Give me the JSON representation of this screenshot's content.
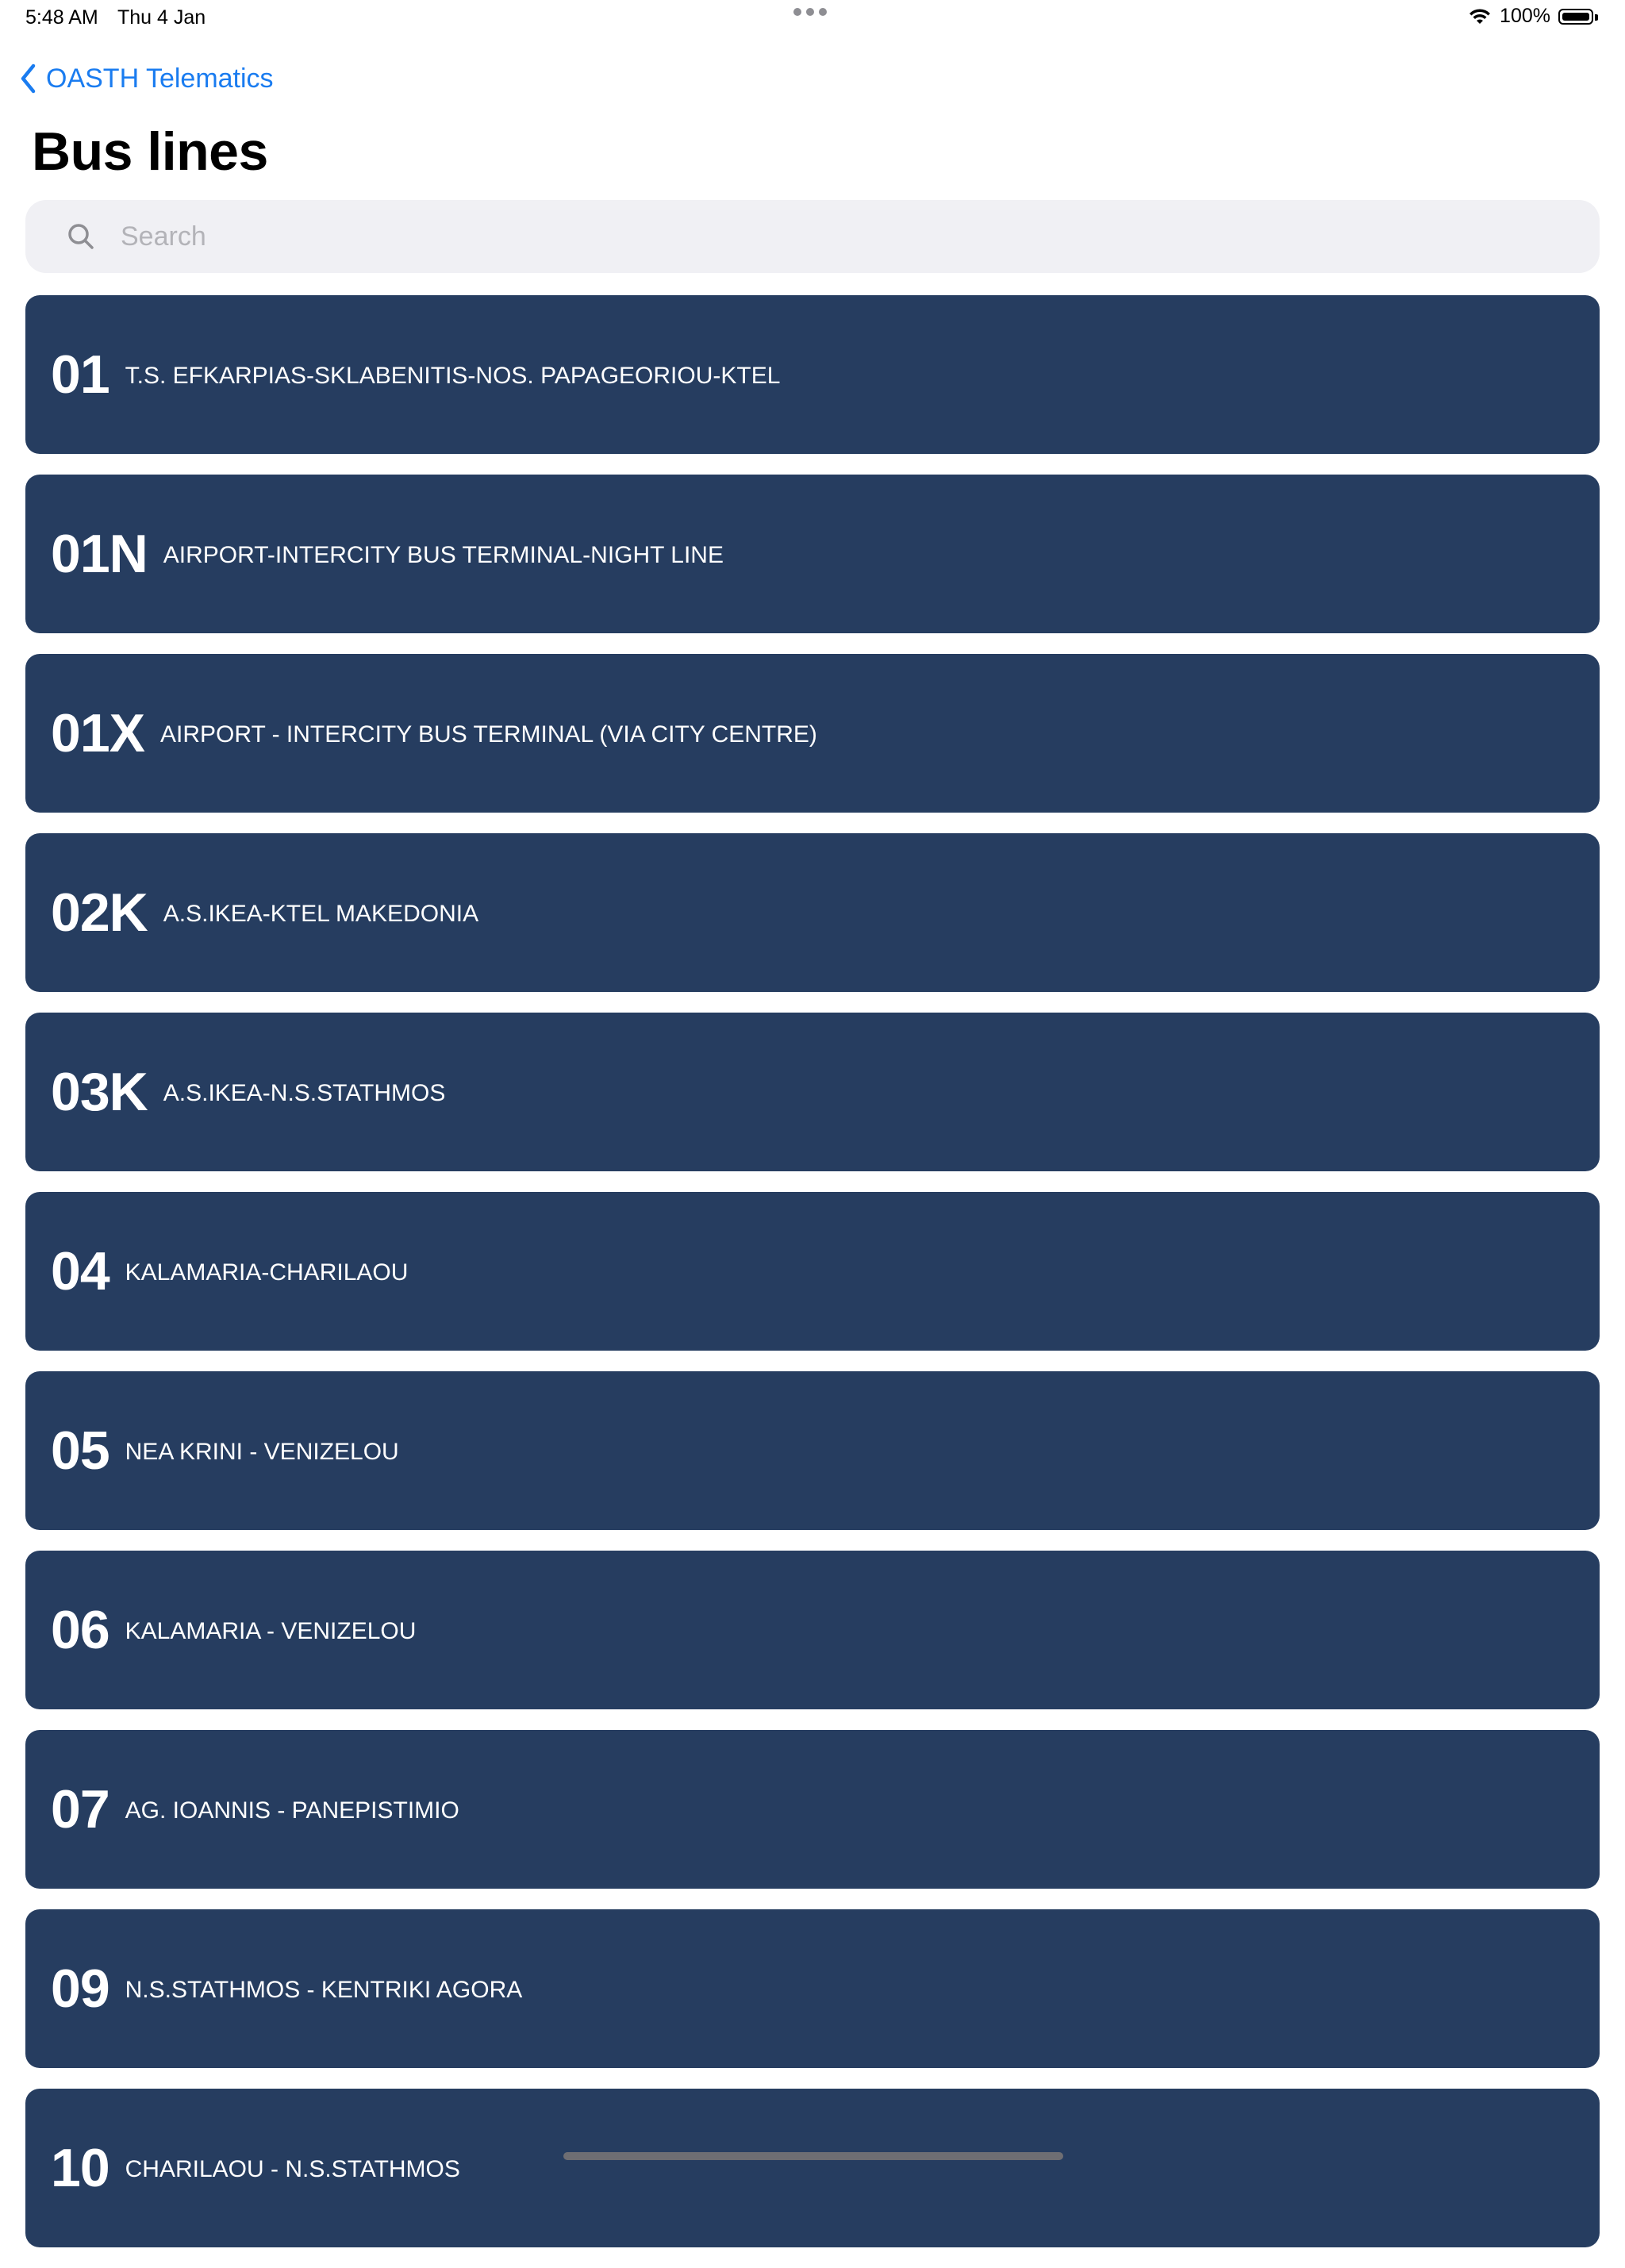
{
  "status_bar": {
    "time": "5:48 AM",
    "date": "Thu 4 Jan",
    "battery": "100%"
  },
  "nav": {
    "back_label": "OASTH Telematics"
  },
  "page": {
    "title": "Bus lines"
  },
  "search": {
    "placeholder": "Search",
    "value": ""
  },
  "lines": [
    {
      "number": "01",
      "name": "T.S. EFKARPIAS-SKLABENITIS-NOS. PAPAGEORIOU-KTEL"
    },
    {
      "number": "01N",
      "name": "AIRPORT-INTERCITY BUS TERMINAL-NIGHT LINE"
    },
    {
      "number": "01X",
      "name": "AIRPORT - INTERCITY BUS TERMINAL (VIA CITY CENTRE)"
    },
    {
      "number": "02K",
      "name": "A.S.IKEA-KTEL MAKEDONIA"
    },
    {
      "number": "03K",
      "name": "A.S.IKEA-N.S.STATHMOS"
    },
    {
      "number": "04",
      "name": "KALAMARIA-CHARILAOU"
    },
    {
      "number": "05",
      "name": "NEA KRINI - VENIZELOU"
    },
    {
      "number": "06",
      "name": "KALAMARIA - VENIZELOU"
    },
    {
      "number": "07",
      "name": "AG. IOANNIS - PANEPISTIMIO"
    },
    {
      "number": "09",
      "name": "N.S.STATHMOS - KENTRIKI AGORA"
    },
    {
      "number": "10",
      "name": "CHARILAOU - N.S.STATHMOS"
    }
  ],
  "colors": {
    "card_background": "#263d60",
    "accent": "#1a7cf0",
    "search_background": "#f0f0f4"
  }
}
